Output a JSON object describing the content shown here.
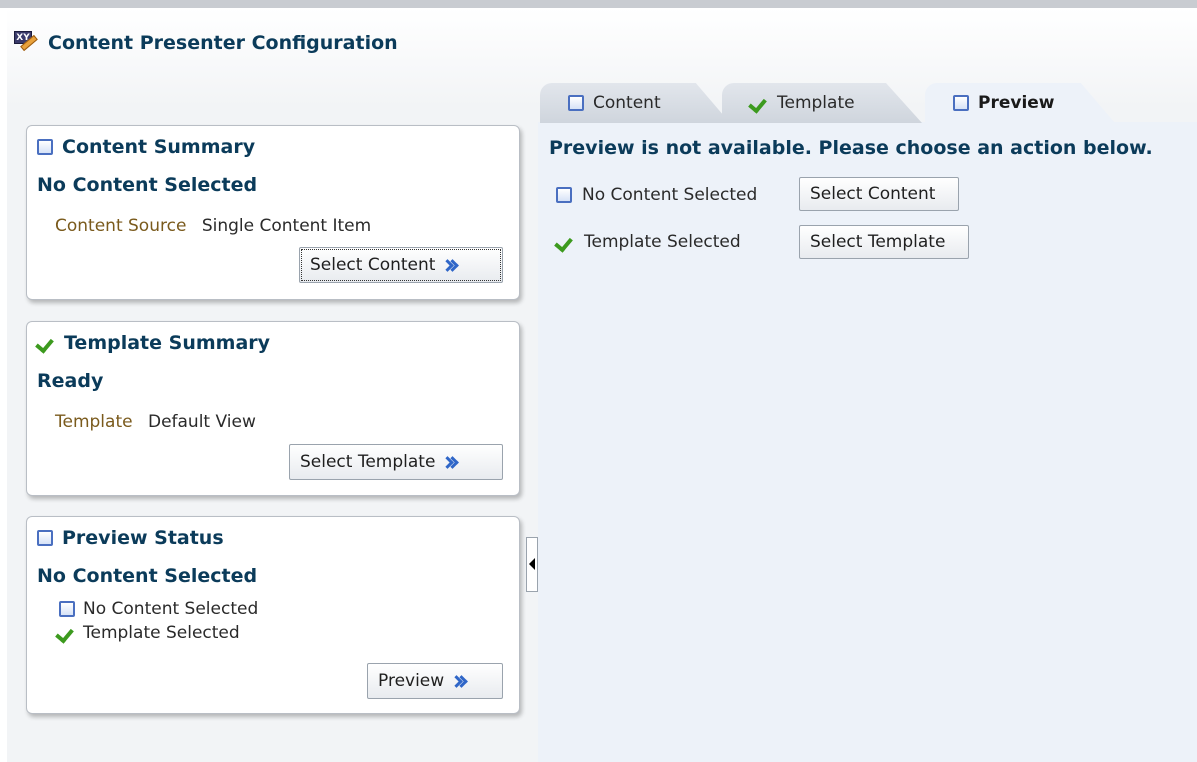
{
  "app": {
    "title": "Content Presenter Configuration"
  },
  "content_summary": {
    "header": "Content Summary",
    "status": "No Content Selected",
    "field_label": "Content Source",
    "field_value": "Single Content Item",
    "button": "Select Content"
  },
  "template_summary": {
    "header": "Template Summary",
    "status": "Ready",
    "field_label": "Template",
    "field_value": "Default View",
    "button": "Select Template"
  },
  "preview_status": {
    "header": "Preview Status",
    "status": "No Content Selected",
    "items": [
      "No Content Selected",
      "Template Selected"
    ],
    "button": "Preview"
  },
  "tabs": [
    {
      "label": "Content",
      "icon": "checkbox-icon",
      "active": false
    },
    {
      "label": "Template",
      "icon": "checkmark-icon",
      "active": false
    },
    {
      "label": "Preview",
      "icon": "checkbox-icon",
      "active": true
    }
  ],
  "preview_pane": {
    "message": "Preview is not available. Please choose an action below.",
    "rows": [
      {
        "label": "No Content Selected",
        "button": "Select Content"
      },
      {
        "label": "Template Selected",
        "button": "Select Template"
      }
    ]
  },
  "colors": {
    "heading": "#0b3b5a",
    "field_label": "#7a5a1c",
    "check_green": "#3c9a1e",
    "checkbox_blue": "#4a6fc0",
    "pane_bg": "#edf2f9"
  }
}
